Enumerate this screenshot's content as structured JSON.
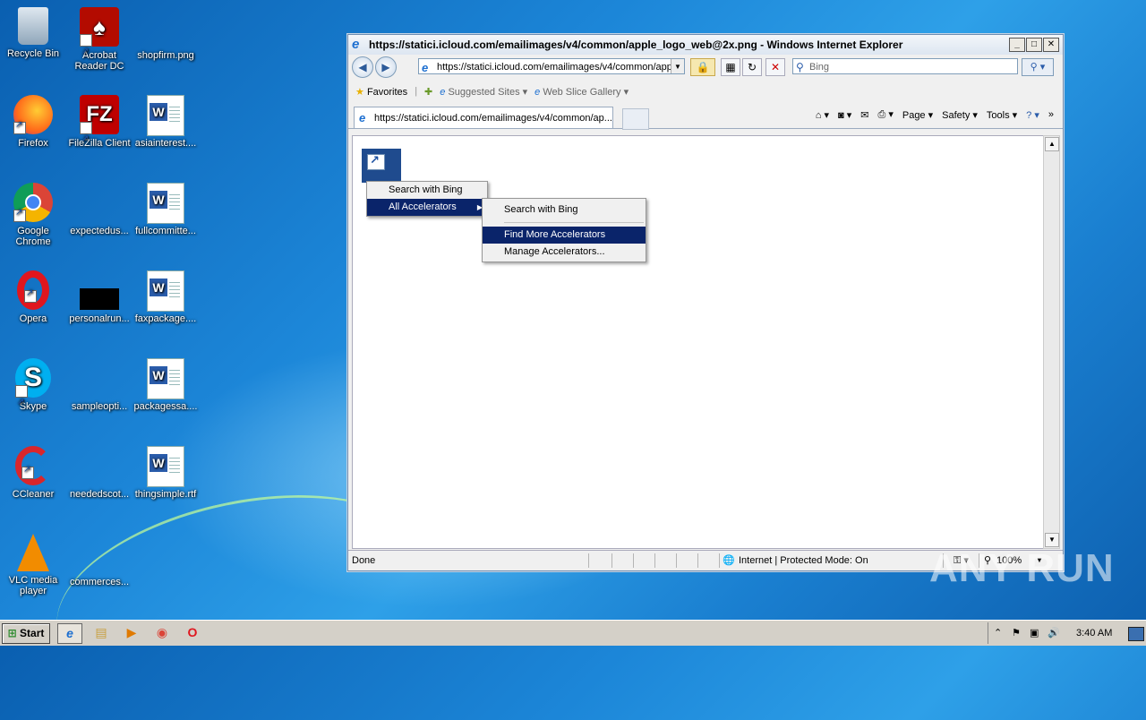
{
  "desktop": {
    "icons": [
      {
        "label": "Recycle Bin"
      },
      {
        "label": "Acrobat Reader DC"
      },
      {
        "label": "shopfirm.png"
      },
      {
        "label": "Firefox"
      },
      {
        "label": "FileZilla Client"
      },
      {
        "label": "asiainterest...."
      },
      {
        "label": "Google Chrome"
      },
      {
        "label": "expectedus..."
      },
      {
        "label": "fullcommitte..."
      },
      {
        "label": "Opera"
      },
      {
        "label": "personalrun..."
      },
      {
        "label": "faxpackage...."
      },
      {
        "label": "Skype"
      },
      {
        "label": "sampleopti..."
      },
      {
        "label": "packagessa...."
      },
      {
        "label": "CCleaner"
      },
      {
        "label": "neededscot..."
      },
      {
        "label": "thingsimple.rtf"
      },
      {
        "label": "VLC media player"
      },
      {
        "label": "commerces..."
      }
    ]
  },
  "ie": {
    "title": "https://statici.icloud.com/emailimages/v4/common/apple_logo_web@2x.png - Windows Internet Explorer",
    "address": "https://statici.icloud.com/emailimages/v4/common/app",
    "search_placeholder": "Bing",
    "favorites_label": "Favorites",
    "suggested_sites": "Suggested Sites ▾",
    "web_slice_gallery": "Web Slice Gallery ▾",
    "tab_title": "https://statici.icloud.com/emailimages/v4/common/ap...",
    "cmd": {
      "page": "Page ▾",
      "safety": "Safety ▾",
      "tools": "Tools ▾"
    },
    "status_left": "Done",
    "status_zone": "Internet | Protected Mode: On",
    "zoom": "100%"
  },
  "menus": {
    "main": [
      "Search with Bing",
      "All Accelerators"
    ],
    "sub": [
      "Search with Bing",
      "Find More Accelerators",
      "Manage Accelerators..."
    ]
  },
  "taskbar": {
    "start": "Start",
    "clock": "3:40 AM"
  },
  "watermark": "ANY RUN"
}
